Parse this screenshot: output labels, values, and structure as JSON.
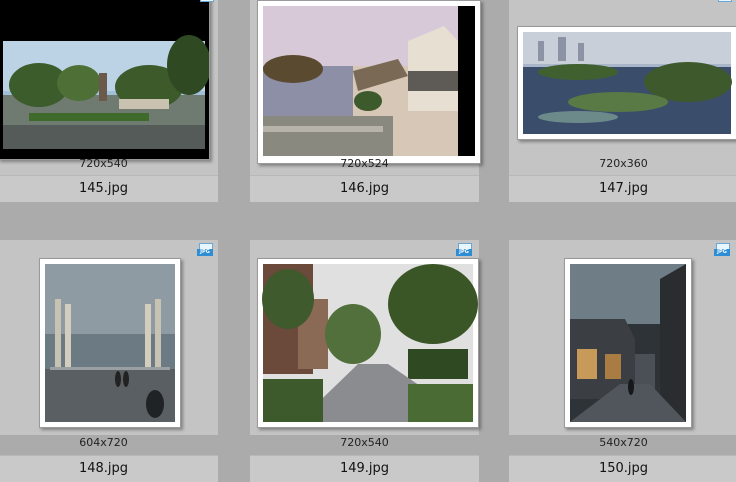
{
  "items": [
    {
      "name": "145.jpg",
      "dims": "720x540",
      "icon": "jpg-file-icon"
    },
    {
      "name": "146.jpg",
      "dims": "720x524",
      "icon": "jpg-file-icon"
    },
    {
      "name": "147.jpg",
      "dims": "720x360",
      "icon": "jpg-file-icon"
    },
    {
      "name": "148.jpg",
      "dims": "604x720",
      "icon": "jpg-file-icon",
      "badge": "JPG"
    },
    {
      "name": "149.jpg",
      "dims": "720x540",
      "icon": "jpg-file-icon",
      "badge": "JPG"
    },
    {
      "name": "150.jpg",
      "dims": "540x720",
      "icon": "jpg-file-icon",
      "badge": "JPG"
    }
  ]
}
